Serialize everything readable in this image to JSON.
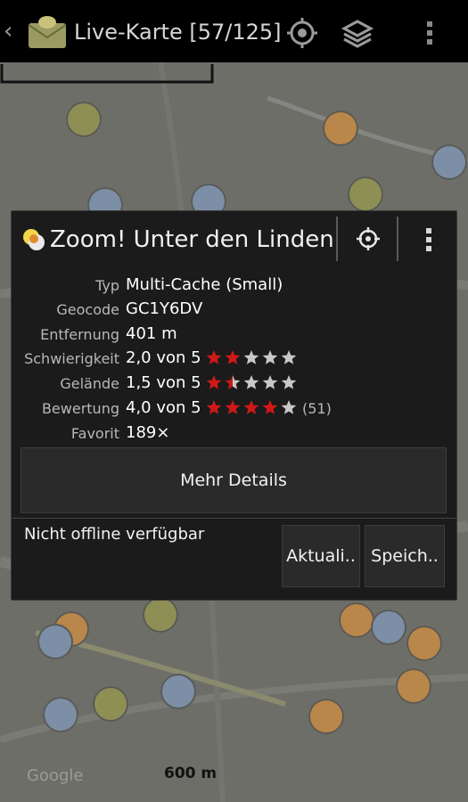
{
  "action_bar": {
    "title": "Live-Karte [57/125]"
  },
  "map": {
    "scale_label": "600 m",
    "attribution": "Google"
  },
  "popup": {
    "title": "Zoom! Unter den Linden",
    "details": [
      {
        "label": "Typ",
        "value": "Multi-Cache (Small)"
      },
      {
        "label": "Geocode",
        "value": "GC1Y6DV"
      },
      {
        "label": "Entfernung",
        "value": "401 m"
      },
      {
        "label": "Schwierigkeit",
        "value": "2,0 von 5",
        "stars": 2.0
      },
      {
        "label": "Gelände",
        "value": "1,5 von 5",
        "stars": 1.5
      },
      {
        "label": "Bewertung",
        "value": "4,0 von 5",
        "stars": 4.0,
        "count": "(51)"
      },
      {
        "label": "Favorit",
        "value": "189×"
      }
    ],
    "more_details_label": "Mehr Details",
    "offline_status": "Nicht offline verfügbar",
    "refresh_label": "Aktuali..",
    "save_label": "Speich.."
  },
  "colors": {
    "star_filled": "#d01818",
    "star_empty": "#c8c8c8"
  }
}
